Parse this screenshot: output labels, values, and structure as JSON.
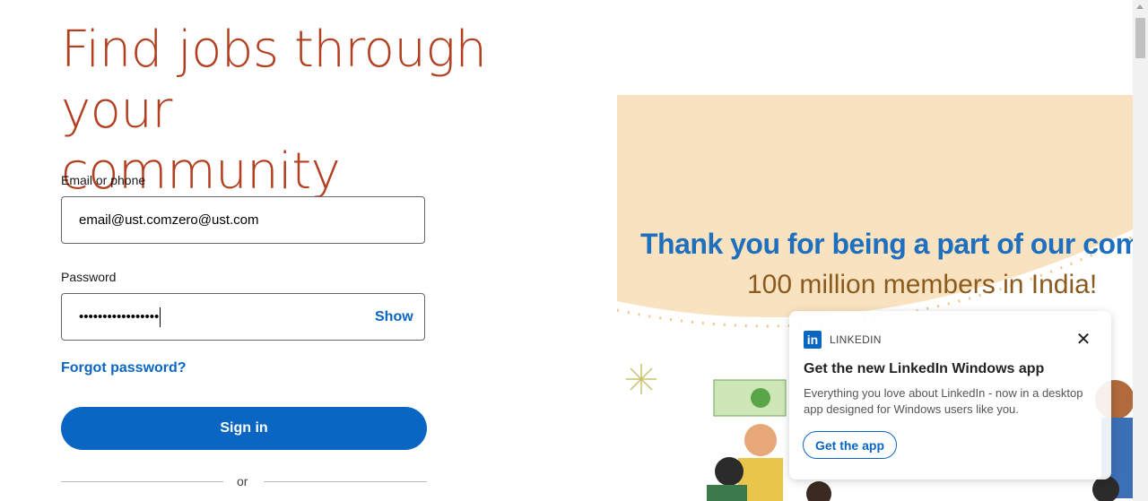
{
  "headline": {
    "line1": "Find jobs through your",
    "line2": "community"
  },
  "form": {
    "email_label": "Email or phone",
    "email_value": "email@ust.comzero@ust.com",
    "password_label": "Password",
    "password_value": "•••••••••••••••••",
    "show_label": "Show",
    "forgot_label": "Forgot password?",
    "signin_label": "Sign in",
    "or_label": "or"
  },
  "banner": {
    "title": "Thank you for being a part of our comm",
    "subtitle": "100 million members in India!"
  },
  "toast": {
    "brand": "LINKEDIN",
    "logo_text": "in",
    "close_icon": "close-icon",
    "title": "Get the new LinkedIn Windows app",
    "body": "Everything you love about LinkedIn - now in a desktop app designed for Windows users like you.",
    "button": "Get the app"
  },
  "colors": {
    "brand_blue": "#0a66c2",
    "headline": "#b24020",
    "banner_bg": "#f8e2c0"
  }
}
